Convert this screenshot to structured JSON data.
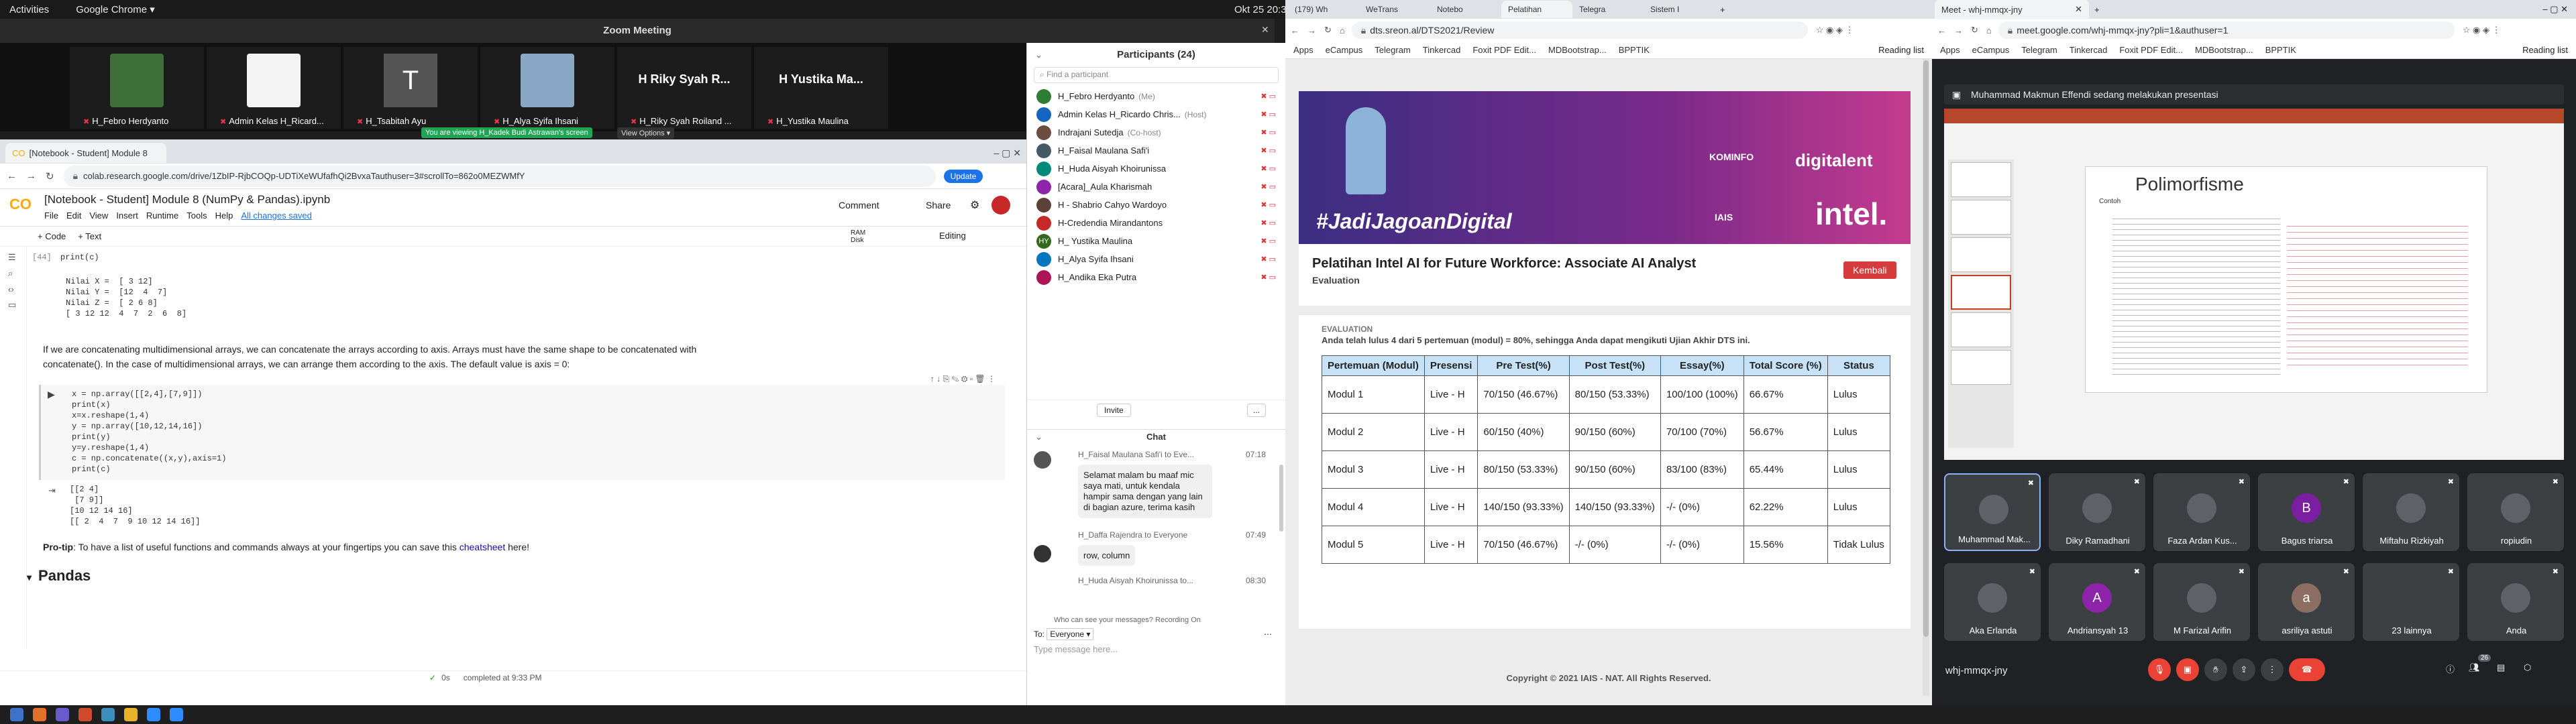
{
  "topbar": {
    "activities": "Activities",
    "app": "Google Chrome ▾",
    "clock": "Okt 25  20:34"
  },
  "zoom": {
    "title": "Zoom Meeting",
    "viewing_banner": "You are viewing H_Kadek Budi Astrawan's screen",
    "view_options": "View Options ▾",
    "tiles": [
      {
        "name": "H_Febro Herdyanto"
      },
      {
        "name": "Admin Kelas H_Ricard..."
      },
      {
        "name": "H_Tsabitah Ayu",
        "initial": "T"
      },
      {
        "name": "H_Alya Syifa Ihsani"
      },
      {
        "name": "H_Riky Syah Roiland ...",
        "big": "H Riky Syah R..."
      },
      {
        "name": "H_Yustika Maulina",
        "big": "H Yustika Ma..."
      }
    ]
  },
  "colab": {
    "tab_title": "[Notebook - Student] Module 8",
    "url": "colab.research.google.com/drive/1ZbIP-RjbCOQp-UDTiXeWUfafhQi2BvxaTauthuser=3#scrollTo=862o0MEZWMfY",
    "update": "Update",
    "notebook_title": "[Notebook - Student] Module 8 (NumPy & Pandas).ipynb",
    "menu": [
      "File",
      "Edit",
      "View",
      "Insert",
      "Runtime",
      "Tools",
      "Help"
    ],
    "saved": "All changes saved",
    "comment": "Comment",
    "share": "Share",
    "add_code": "+ Code",
    "add_text": "+ Text",
    "ram": "RAM",
    "disk": "Disk",
    "editing": "Editing",
    "cell1_num": "[44]",
    "cell1_code": "print(c)",
    "output1": "Nilai X =  [ 3 12]\nNilai Y =  [12  4  7]\nNilai Z =  [ 2 6 8]\n[ 3 12 12  4  7  2  6  8]",
    "text_para": "If we are concatenating multidimensional arrays, we can concatenate the arrays according to axis. Arrays must have the same shape to be concatenated with concatenate(). In the case of multidimensional arrays, we can arrange them according to the axis. The default value is axis = 0:",
    "cell2_code": "x = np.array([[2,4],[7,9]])\nprint(x)\nx=x.reshape(1,4)\ny = np.array([10,12,14,16])\nprint(y)\ny=y.reshape(1,4)\nc = np.concatenate((x,y),axis=1)\nprint(c)",
    "output2": "[[2 4]\n [7 9]]\n[10 12 14 16]\n[[ 2  4  7  9 10 12 14 16]]",
    "protip_bold": "Pro-tip",
    "protip_text": ": To have a list of useful functions and commands always at your fingertips you can save this ",
    "protip_link": "cheatsheet",
    "protip_end": " here!",
    "section": "Pandas",
    "status_time": "0s",
    "status": "completed at 9:33 PM"
  },
  "participants": {
    "title": "Participants (24)",
    "search_placeholder": "Find a participant",
    "list": [
      {
        "name": "H_Febro Herdyanto",
        "tag": "(Me)",
        "color": "#2e7d32"
      },
      {
        "name": "Admin Kelas H_Ricardo Chris...",
        "tag": "(Host)",
        "color": "#1565c0"
      },
      {
        "name": "Indrajani Sutedja",
        "tag": "(Co-host)",
        "color": "#6d4c41"
      },
      {
        "name": "H_Faisal Maulana Safi'i",
        "tag": "",
        "color": "#455a64"
      },
      {
        "name": "H_Huda Aisyah Khoirunissa",
        "tag": "",
        "color": "#00897b"
      },
      {
        "name": "[Acara]_Aula Kharismah",
        "tag": "",
        "color": "#8e24aa"
      },
      {
        "name": "H - Shabrio Cahyo Wardoyo",
        "tag": "",
        "color": "#5d4037"
      },
      {
        "name": "H-Credendia Mirandantons",
        "tag": "",
        "color": "#c62828"
      },
      {
        "name": "H_ Yustika Maulina",
        "tag": "",
        "color": "#33691e",
        "initials": "HY"
      },
      {
        "name": "H_Alya Syifa Ihsani",
        "tag": "",
        "color": "#0277bd"
      },
      {
        "name": "H_Andika Eka Putra",
        "tag": "",
        "color": "#ad1457"
      }
    ],
    "invite": "Invite",
    "more": "..."
  },
  "chat": {
    "title": "Chat",
    "messages": [
      {
        "from": "H_Faisal Maulana Safi'i to Eve...",
        "time": "07:18",
        "text": "Selamat malam bu maaf mic saya mati, untuk kendala hampir sama dengan yang lain di bagian azure, terima kasih"
      },
      {
        "from": "H_Daffa Rajendra to Everyone",
        "time": "07:49",
        "text": "row, column"
      },
      {
        "from": "H_Huda Aisyah Khoirunissa to...",
        "time": "08:30",
        "text": ""
      }
    ],
    "privacy": "Who can see your messages? Recording On",
    "to_label": "To:",
    "to_value": "Everyone ▾",
    "placeholder": "Type message here..."
  },
  "dts": {
    "tabs": [
      "(179) Wh",
      "WeTrans",
      "Notebo",
      "Pelatihan",
      "Telegra",
      "Sistem I"
    ],
    "active_tab": 3,
    "url": "dts.sreon.al/DTS2021/Review",
    "bookmarks": [
      "Apps",
      "eCampus",
      "Telegram",
      "Tinkercad",
      "Foxit PDF Edit...",
      "MDBootstrap...",
      "BPPTIK"
    ],
    "reading_list": "Reading list",
    "banner_hashtag": "#JadiJagoanDigital",
    "banner_kominfo": "KOMINFO",
    "banner_digitalent": "digitalent",
    "banner_iais": "IAIS",
    "banner_intel": "intel.",
    "course_title": "Pelatihan Intel AI for Future Workforce: Associate AI Analyst",
    "course_sub": "Evaluation",
    "back": "Kembali",
    "eval_head": "EVALUATION",
    "eval_note": "Anda telah lulus 4 dari 5 pertemuan (modul) = 80%, sehingga Anda dapat mengikuti Ujian Akhir DTS ini.",
    "columns": [
      "Pertemuan (Modul)",
      "Presensi",
      "Pre Test(%)",
      "Post Test(%)",
      "Essay(%)",
      "Total Score (%)",
      "Status"
    ],
    "rows": [
      [
        "Modul 1",
        "Live - H",
        "70/150 (46.67%)",
        "80/150 (53.33%)",
        "100/100 (100%)",
        "66.67%",
        "Lulus"
      ],
      [
        "Modul 2",
        "Live - H",
        "60/150 (40%)",
        "90/150 (60%)",
        "70/100 (70%)",
        "56.67%",
        "Lulus"
      ],
      [
        "Modul 3",
        "Live - H",
        "80/150 (53.33%)",
        "90/150 (60%)",
        "83/100 (83%)",
        "65.44%",
        "Lulus"
      ],
      [
        "Modul 4",
        "Live - H",
        "140/150 (93.33%)",
        "140/150 (93.33%)",
        "-/- (0%)",
        "62.22%",
        "Lulus"
      ],
      [
        "Modul 5",
        "Live - H",
        "70/150 (46.67%)",
        "-/- (0%)",
        "-/- (0%)",
        "15.56%",
        "Tidak Lulus"
      ]
    ],
    "copyright": "Copyright © 2021 IAIS - NAT. All Rights Reserved."
  },
  "meet": {
    "tab": "Meet - whj-mmqx-jny",
    "url": "meet.google.com/whj-mmqx-jny?pli=1&authuser=1",
    "bookmarks": [
      "Apps",
      "eCampus",
      "Telegram",
      "Tinkercad",
      "Foxit PDF Edit...",
      "MDBootstrap...",
      "BPPTIK"
    ],
    "reading_list": "Reading list",
    "presenting": "Muhammad Makmun Effendi sedang melakukan presentasi",
    "slide_title": "Polimorfisme",
    "slide_sub": "Contoh",
    "code_name": "whj-mmqx-jny",
    "people_count": "26",
    "tiles": [
      {
        "name": "Muhammad Mak...",
        "initial": "",
        "color": "#5f6368"
      },
      {
        "name": "Diky Ramadhani",
        "initial": "",
        "color": "#5f6368"
      },
      {
        "name": "Faza Ardan Kus...",
        "initial": "",
        "color": "#5f6368"
      },
      {
        "name": "Bagus triarsa",
        "initial": "B",
        "color": "#7b1fa2"
      },
      {
        "name": "Miftahu Rizkiyah",
        "initial": "",
        "color": "#5f6368"
      },
      {
        "name": "ropiudin",
        "initial": "",
        "color": "#5f6368"
      },
      {
        "name": "Aka Erlanda",
        "initial": "",
        "color": "#5f6368"
      },
      {
        "name": "Andriansyah 13",
        "initial": "A",
        "color": "#8e24aa"
      },
      {
        "name": "M Farizal Arifin",
        "initial": "",
        "color": "#5f6368"
      },
      {
        "name": "asriliya astuti",
        "initial": "a",
        "color": "#8d6e63"
      },
      {
        "name": "23 lainnya",
        "initial": "",
        "color": "#3c4043"
      },
      {
        "name": "Anda",
        "initial": "",
        "color": "#5f6368"
      }
    ]
  }
}
